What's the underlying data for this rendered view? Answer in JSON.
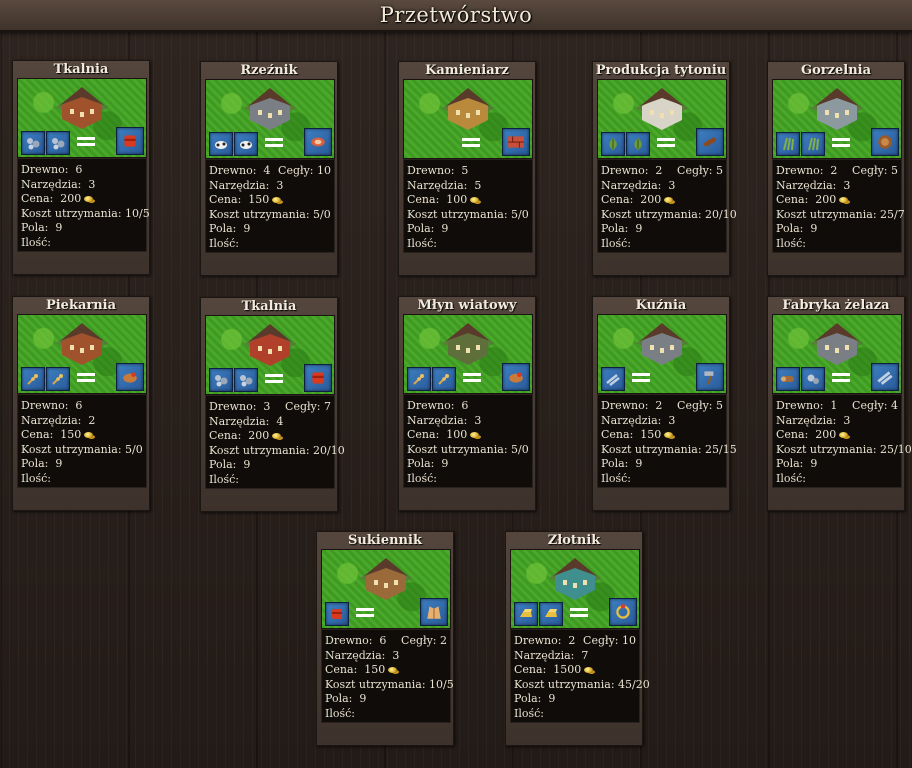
{
  "window": {
    "title": "Przetwórstwo"
  },
  "labels": {
    "wood": "Drewno:",
    "bricks": "Cegły:",
    "tools": "Narzędzia:",
    "price": "Cena:",
    "upkeep": "Koszt utrzymania:",
    "fields": "Pola:",
    "count": "Ilość:"
  },
  "colors": {
    "slot_bg": "#3d7fc1",
    "coin": "#d7a821",
    "stats_bg": "#0f0c0a"
  },
  "buildings": [
    {
      "name": "Tkalnia",
      "wood": "6",
      "bricks": "",
      "tools": "3",
      "price": "200",
      "upkeep": "10/5",
      "fields": "9",
      "count": "",
      "inputs": [
        "stone-icon",
        "stone-icon"
      ],
      "output": "cloth-icon",
      "building_icon": "weaving-mill-icon"
    },
    {
      "name": "Rzeźnik",
      "wood": "4",
      "bricks": "10",
      "tools": "3",
      "price": "150",
      "upkeep": "5/0",
      "fields": "9",
      "count": "",
      "inputs": [
        "cow-icon",
        "cow-icon"
      ],
      "output": "meat-icon",
      "building_icon": "butcher-icon"
    },
    {
      "name": "Kamieniarz",
      "wood": "5",
      "bricks": "",
      "tools": "5",
      "price": "100",
      "upkeep": "5/0",
      "fields": "9",
      "count": "",
      "inputs": [],
      "output": "bricks-icon",
      "building_icon": "stonemason-icon"
    },
    {
      "name": "Produkcja tytoniu",
      "wood": "2",
      "bricks": "5",
      "tools": "3",
      "price": "200",
      "upkeep": "20/10",
      "fields": "9",
      "count": "",
      "inputs": [
        "tobacco-leaf-icon",
        "tobacco-leaf-icon"
      ],
      "output": "cigar-icon",
      "building_icon": "tobacco-factory-icon"
    },
    {
      "name": "Gorzelnia",
      "wood": "2",
      "bricks": "5",
      "tools": "3",
      "price": "200",
      "upkeep": "25/7",
      "fields": "9",
      "count": "",
      "inputs": [
        "sugar-cane-icon",
        "sugar-cane-icon"
      ],
      "output": "rum-barrel-icon",
      "building_icon": "distillery-icon"
    },
    {
      "name": "Piekarnia",
      "wood": "6",
      "bricks": "",
      "tools": "2",
      "price": "150",
      "upkeep": "5/0",
      "fields": "9",
      "count": "",
      "inputs": [
        "wheat-icon",
        "wheat-icon"
      ],
      "output": "bread-icon",
      "building_icon": "bakery-icon"
    },
    {
      "name": "Tkalnia",
      "wood": "3",
      "bricks": "7",
      "tools": "4",
      "price": "200",
      "upkeep": "20/10",
      "fields": "9",
      "count": "",
      "inputs": [
        "stone-icon",
        "stone-icon"
      ],
      "output": "cloth-icon",
      "building_icon": "weaving-mill-icon"
    },
    {
      "name": "Młyn wiatowy",
      "wood": "6",
      "bricks": "",
      "tools": "3",
      "price": "100",
      "upkeep": "5/0",
      "fields": "9",
      "count": "",
      "inputs": [
        "wheat-icon",
        "wheat-icon"
      ],
      "output": "bread-icon",
      "building_icon": "windmill-icon"
    },
    {
      "name": "Kuźnia",
      "wood": "2",
      "bricks": "5",
      "tools": "3",
      "price": "150",
      "upkeep": "25/15",
      "fields": "9",
      "count": "",
      "inputs": [
        "iron-bar-icon"
      ],
      "output": "hammer-icon",
      "building_icon": "smithy-icon"
    },
    {
      "name": "Fabryka żelaza",
      "wood": "1",
      "bricks": "4",
      "tools": "3",
      "price": "200",
      "upkeep": "25/10",
      "fields": "9",
      "count": "",
      "inputs": [
        "log-icon",
        "iron-ore-icon"
      ],
      "output": "iron-bar-icon",
      "building_icon": "ironworks-icon"
    },
    {
      "name": "Sukiennik",
      "wood": "6",
      "bricks": "2",
      "tools": "3",
      "price": "150",
      "upkeep": "10/5",
      "fields": "9",
      "count": "",
      "inputs": [
        "cloth-icon"
      ],
      "output": "coat-icon",
      "building_icon": "clothier-icon"
    },
    {
      "name": "Złotnik",
      "wood": "2",
      "bricks": "10",
      "tools": "7",
      "price": "1500",
      "upkeep": "45/20",
      "fields": "9",
      "count": "",
      "inputs": [
        "gold-bar-icon",
        "gold-bar-icon"
      ],
      "output": "jewelry-icon",
      "building_icon": "goldsmith-icon"
    }
  ]
}
